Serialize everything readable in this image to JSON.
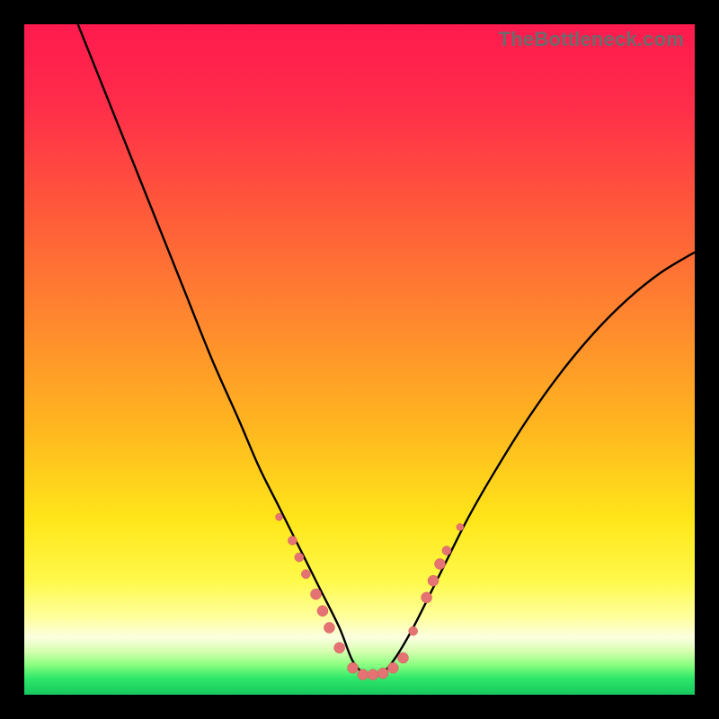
{
  "watermark": "TheBottleneck.com",
  "colors": {
    "gradient_stops": [
      {
        "offset": 0.0,
        "color": "#ff1a4e"
      },
      {
        "offset": 0.12,
        "color": "#ff2d4a"
      },
      {
        "offset": 0.28,
        "color": "#ff5a3a"
      },
      {
        "offset": 0.45,
        "color": "#ff8a2e"
      },
      {
        "offset": 0.6,
        "color": "#ffb61f"
      },
      {
        "offset": 0.74,
        "color": "#ffe61a"
      },
      {
        "offset": 0.83,
        "color": "#fff94a"
      },
      {
        "offset": 0.885,
        "color": "#ffff9e"
      },
      {
        "offset": 0.915,
        "color": "#fbffe0"
      },
      {
        "offset": 0.935,
        "color": "#d7ffb0"
      },
      {
        "offset": 0.955,
        "color": "#8cff80"
      },
      {
        "offset": 0.975,
        "color": "#30e86a"
      },
      {
        "offset": 1.0,
        "color": "#16c85e"
      }
    ],
    "curve": "#000000",
    "marker_fill": "#e57373",
    "marker_stroke": "#cf5b5b"
  },
  "chart_data": {
    "type": "line",
    "title": "",
    "xlabel": "",
    "ylabel": "",
    "xlim": [
      0,
      100
    ],
    "ylim": [
      0,
      100
    ],
    "series": [
      {
        "name": "bottleneck-curve",
        "x": [
          8,
          12,
          16,
          20,
          24,
          28,
          32,
          35,
          38,
          41,
          44,
          47,
          49,
          51,
          53,
          55,
          58,
          62,
          66,
          70,
          75,
          80,
          85,
          90,
          95,
          100
        ],
        "y": [
          100,
          90,
          80,
          70,
          60,
          50,
          41,
          34,
          28,
          22,
          16,
          10,
          5,
          3,
          3,
          5,
          10,
          18,
          26,
          33,
          41,
          48,
          54,
          59,
          63,
          66
        ]
      }
    ],
    "markers": {
      "name": "highlight-points",
      "points": [
        {
          "x": 38.0,
          "y": 26.5,
          "r": 4
        },
        {
          "x": 40.0,
          "y": 23.0,
          "r": 5
        },
        {
          "x": 41.0,
          "y": 20.5,
          "r": 5
        },
        {
          "x": 42.0,
          "y": 18.0,
          "r": 5
        },
        {
          "x": 43.5,
          "y": 15.0,
          "r": 6
        },
        {
          "x": 44.5,
          "y": 12.5,
          "r": 6
        },
        {
          "x": 45.5,
          "y": 10.0,
          "r": 6
        },
        {
          "x": 47.0,
          "y": 7.0,
          "r": 6
        },
        {
          "x": 49.0,
          "y": 4.0,
          "r": 6
        },
        {
          "x": 50.5,
          "y": 3.0,
          "r": 6
        },
        {
          "x": 52.0,
          "y": 3.0,
          "r": 6
        },
        {
          "x": 53.5,
          "y": 3.2,
          "r": 6
        },
        {
          "x": 55.0,
          "y": 4.0,
          "r": 6
        },
        {
          "x": 56.5,
          "y": 5.5,
          "r": 6
        },
        {
          "x": 58.0,
          "y": 9.5,
          "r": 5
        },
        {
          "x": 60.0,
          "y": 14.5,
          "r": 6
        },
        {
          "x": 61.0,
          "y": 17.0,
          "r": 6
        },
        {
          "x": 62.0,
          "y": 19.5,
          "r": 6
        },
        {
          "x": 63.0,
          "y": 21.5,
          "r": 5
        },
        {
          "x": 65.0,
          "y": 25.0,
          "r": 4
        }
      ]
    }
  }
}
